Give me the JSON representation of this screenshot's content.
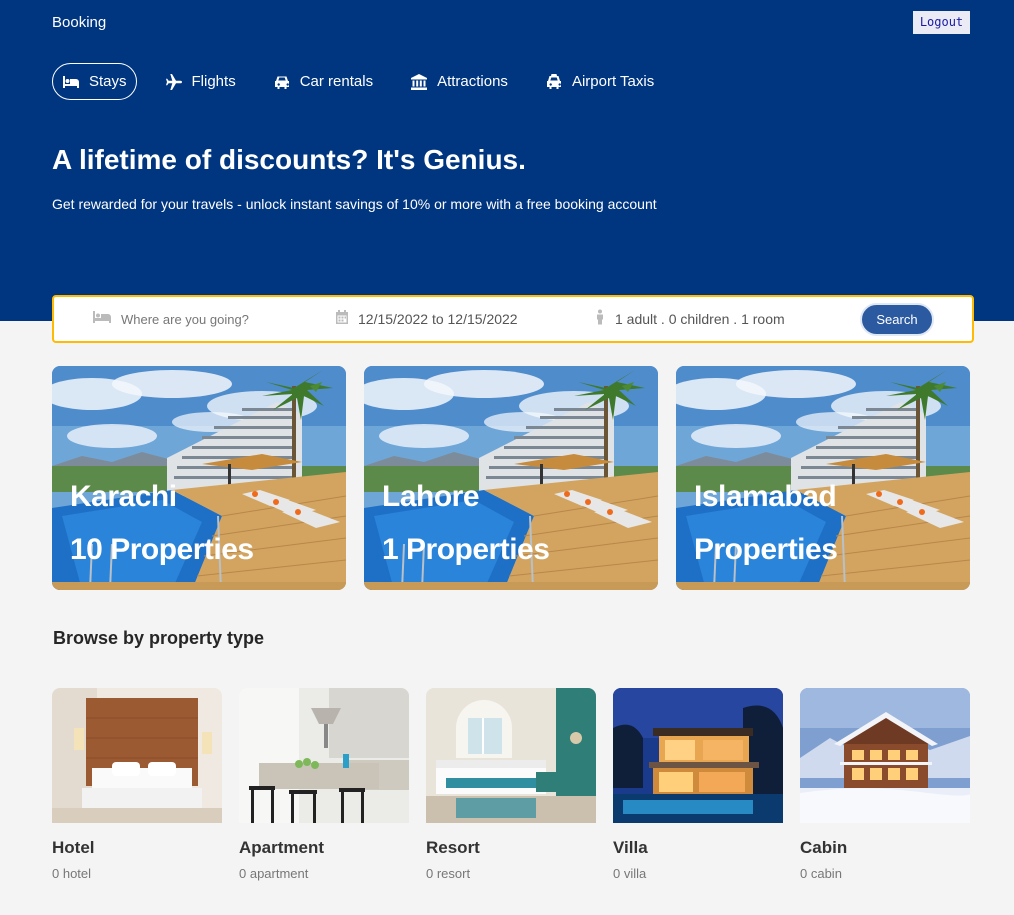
{
  "brand": "Booking",
  "logout_label": "Logout",
  "nav": [
    {
      "label": "Stays",
      "icon": "bed-icon",
      "active": true
    },
    {
      "label": "Flights",
      "icon": "plane-icon",
      "active": false
    },
    {
      "label": "Car rentals",
      "icon": "car-icon",
      "active": false
    },
    {
      "label": "Attractions",
      "icon": "landmark-icon",
      "active": false
    },
    {
      "label": "Airport Taxis",
      "icon": "taxi-icon",
      "active": false
    }
  ],
  "hero": {
    "title": "A lifetime of discounts? It's Genius.",
    "subtitle": "Get rewarded for your travels - unlock instant savings of 10% or more with a free booking account"
  },
  "search": {
    "destination_placeholder": "Where are you going?",
    "dates": "12/15/2022 to 12/15/2022",
    "guests": "1 adult . 0 children . 1 room",
    "button_label": "Search"
  },
  "cities": [
    {
      "name": "Karachi",
      "count": "10 Properties"
    },
    {
      "name": "Lahore",
      "count": "1 Properties"
    },
    {
      "name": "Islamabad",
      "count": "Properties"
    }
  ],
  "property_section_title": "Browse by property type",
  "property_types": [
    {
      "name": "Hotel",
      "count": "0 hotel"
    },
    {
      "name": "Apartment",
      "count": "0 apartment"
    },
    {
      "name": "Resort",
      "count": "0 resort"
    },
    {
      "name": "Villa",
      "count": "0 villa"
    },
    {
      "name": "Cabin",
      "count": "0 cabin"
    }
  ],
  "colors": {
    "header_bg": "#003580",
    "search_border": "#febb02",
    "search_button": "#2c5aa0",
    "page_bg": "#f4f4f4"
  }
}
